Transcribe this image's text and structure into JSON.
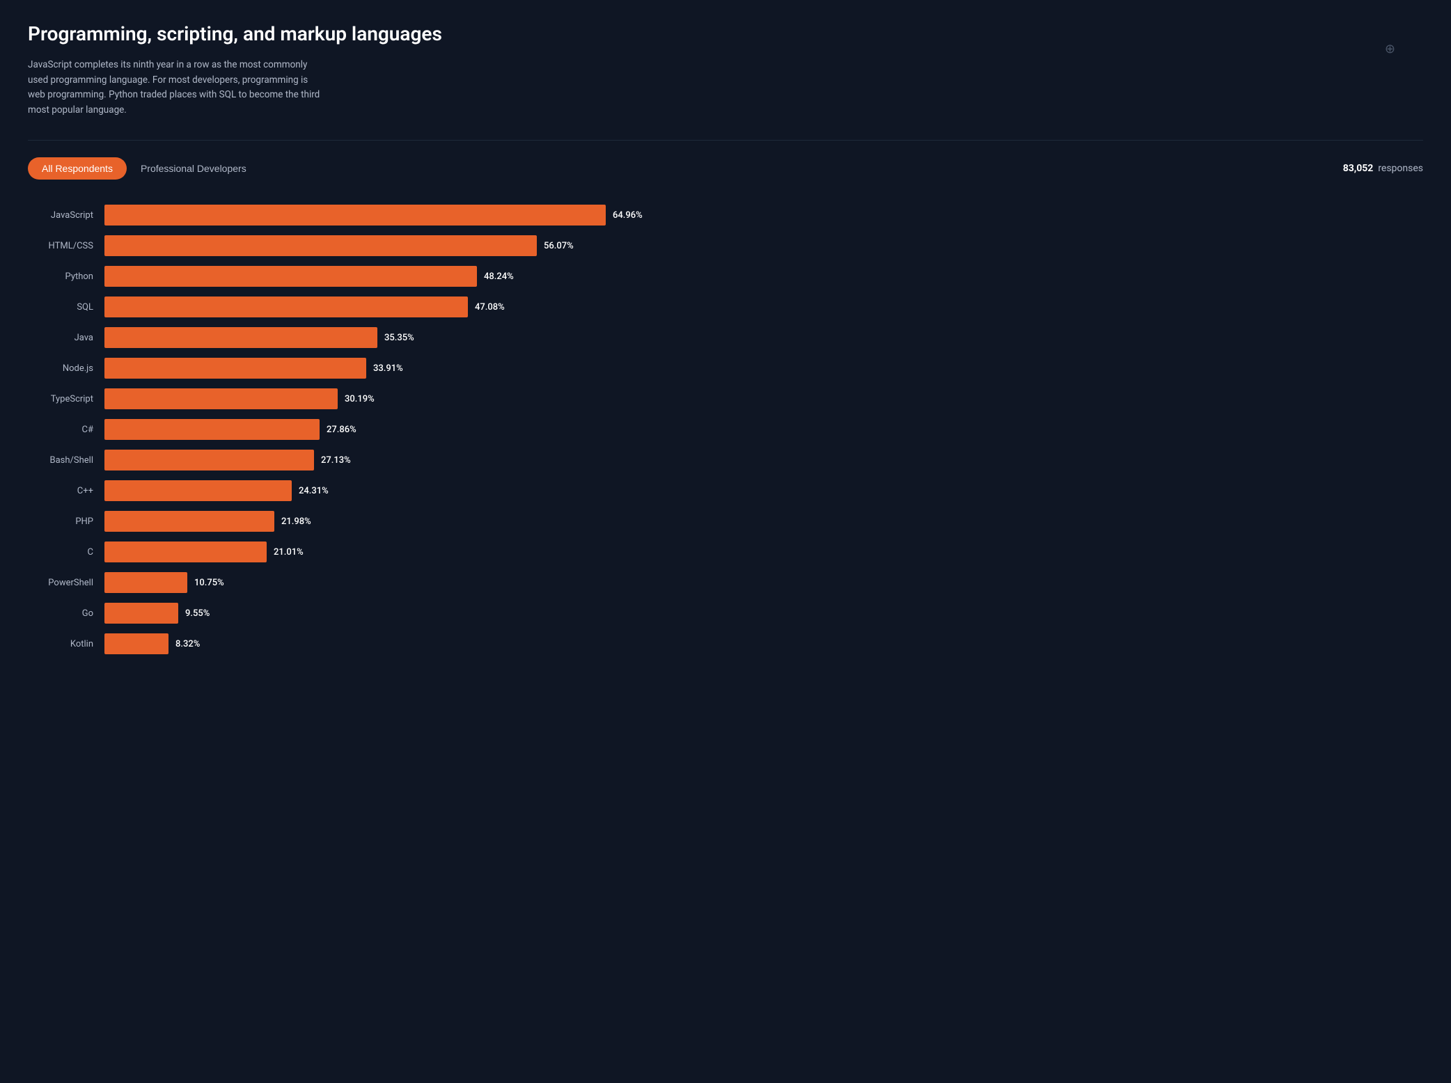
{
  "header": {
    "title": "Programming, scripting, and markup languages",
    "description": "JavaScript completes its ninth year in a row as the most commonly used programming language. For most developers, programming is web programming. Python traded places with SQL to become the third most popular language.",
    "link_icon": "🔗"
  },
  "filters": {
    "tab_all_label": "All Respondents",
    "tab_pro_label": "Professional Developers",
    "responses_label": "responses",
    "responses_count": "83,052"
  },
  "chart": {
    "max_width_pct": 100,
    "bars": [
      {
        "label": "JavaScript",
        "pct": 64.96,
        "pct_label": "64.96%"
      },
      {
        "label": "HTML/CSS",
        "pct": 56.07,
        "pct_label": "56.07%"
      },
      {
        "label": "Python",
        "pct": 48.24,
        "pct_label": "48.24%"
      },
      {
        "label": "SQL",
        "pct": 47.08,
        "pct_label": "47.08%"
      },
      {
        "label": "Java",
        "pct": 35.35,
        "pct_label": "35.35%"
      },
      {
        "label": "Node.js",
        "pct": 33.91,
        "pct_label": "33.91%"
      },
      {
        "label": "TypeScript",
        "pct": 30.19,
        "pct_label": "30.19%"
      },
      {
        "label": "C#",
        "pct": 27.86,
        "pct_label": "27.86%"
      },
      {
        "label": "Bash/Shell",
        "pct": 27.13,
        "pct_label": "27.13%"
      },
      {
        "label": "C++",
        "pct": 24.31,
        "pct_label": "24.31%"
      },
      {
        "label": "PHP",
        "pct": 21.98,
        "pct_label": "21.98%"
      },
      {
        "label": "C",
        "pct": 21.01,
        "pct_label": "21.01%"
      },
      {
        "label": "PowerShell",
        "pct": 10.75,
        "pct_label": "10.75%"
      },
      {
        "label": "Go",
        "pct": 9.55,
        "pct_label": "9.55%"
      },
      {
        "label": "Kotlin",
        "pct": 8.32,
        "pct_label": "8.32%"
      }
    ]
  }
}
